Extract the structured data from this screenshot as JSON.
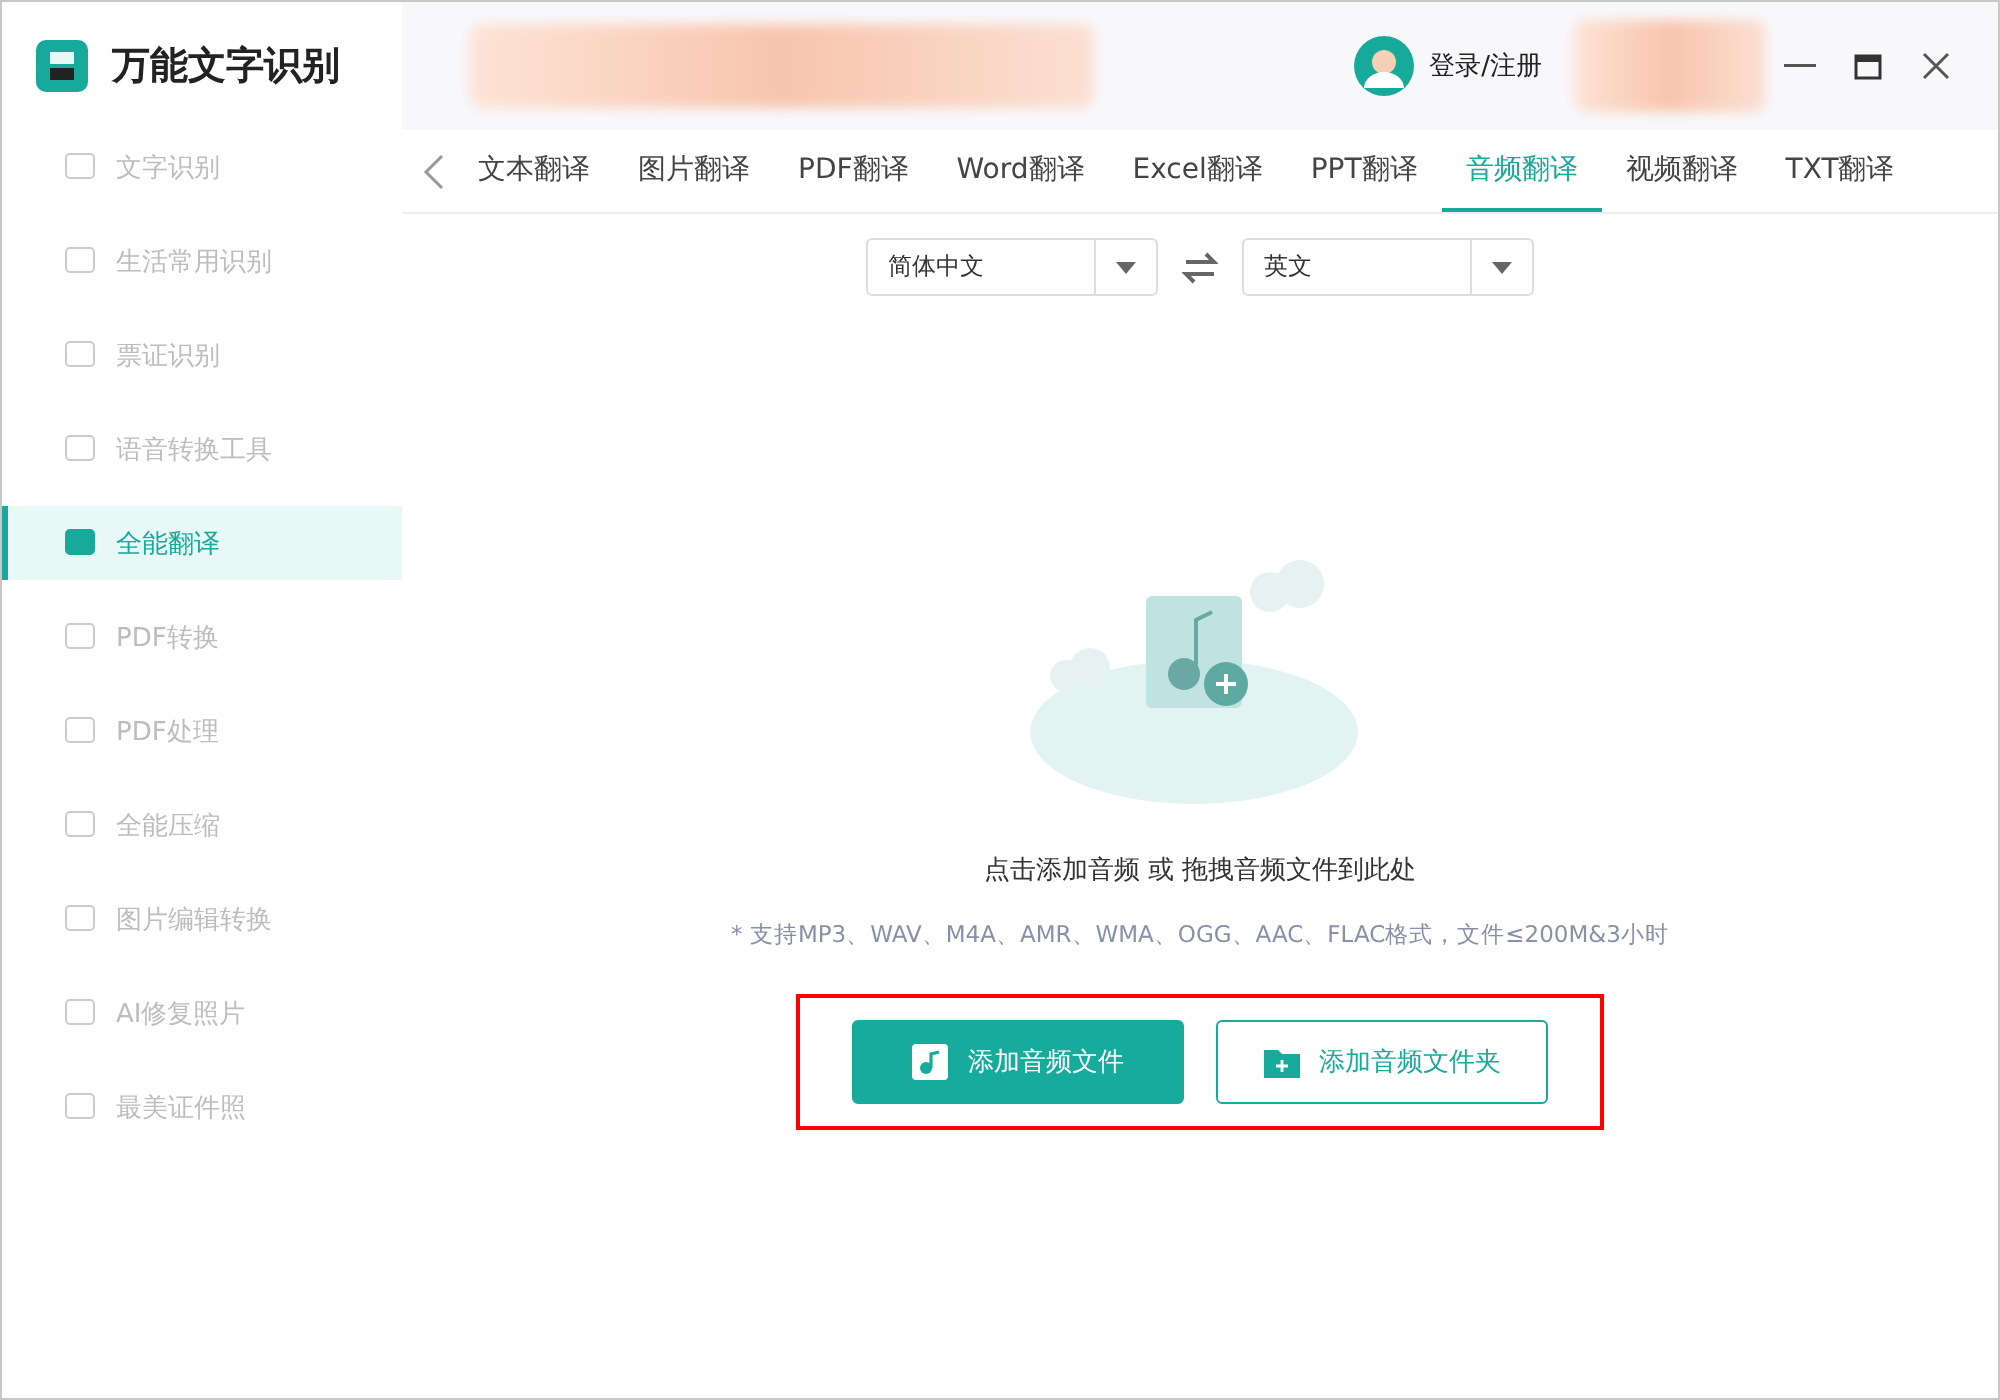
{
  "app": {
    "title": "万能文字识别"
  },
  "sidebar": {
    "items": [
      {
        "label": "文字识别",
        "selected": false
      },
      {
        "label": "生活常用识别",
        "selected": false
      },
      {
        "label": "票证识别",
        "selected": false
      },
      {
        "label": "语音转换工具",
        "selected": false
      },
      {
        "label": "全能翻译",
        "selected": true
      },
      {
        "label": "PDF转换",
        "selected": false
      },
      {
        "label": "PDF处理",
        "selected": false
      },
      {
        "label": "全能压缩",
        "selected": false
      },
      {
        "label": "图片编辑转换",
        "selected": false
      },
      {
        "label": "AI修复照片",
        "selected": false
      },
      {
        "label": "最美证件照",
        "selected": false
      }
    ]
  },
  "header": {
    "login": "登录/注册"
  },
  "tabs": [
    {
      "label": "文本翻译",
      "selected": false
    },
    {
      "label": "图片翻译",
      "selected": false
    },
    {
      "label": "PDF翻译",
      "selected": false
    },
    {
      "label": "Word翻译",
      "selected": false
    },
    {
      "label": "Excel翻译",
      "selected": false
    },
    {
      "label": "PPT翻译",
      "selected": false
    },
    {
      "label": "音频翻译",
      "selected": true
    },
    {
      "label": "视频翻译",
      "selected": false
    },
    {
      "label": "TXT翻译",
      "selected": false
    }
  ],
  "languages": {
    "source": "简体中文",
    "target": "英文"
  },
  "upload": {
    "prompt": "点击添加音频 或 拖拽音频文件到此处",
    "formats": "* 支持MP3、WAV、M4A、AMR、WMA、OGG、AAC、FLAC格式，文件≤200M&3小时",
    "buttons": [
      {
        "kind": "primary",
        "label": "添加音频文件"
      },
      {
        "kind": "outline",
        "label": "添加音频文件夹"
      }
    ]
  }
}
